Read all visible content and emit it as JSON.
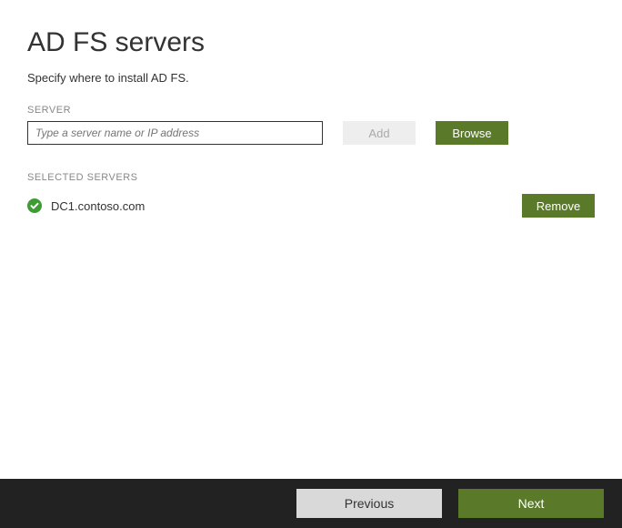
{
  "page": {
    "title": "AD FS servers",
    "subtitle": "Specify where to install AD FS."
  },
  "server_input": {
    "label": "SERVER",
    "placeholder": "Type a server name or IP address",
    "value": ""
  },
  "buttons": {
    "add": "Add",
    "browse": "Browse",
    "remove": "Remove",
    "previous": "Previous",
    "next": "Next"
  },
  "selected": {
    "label": "SELECTED SERVERS",
    "items": [
      {
        "name": "DC1.contoso.com"
      }
    ]
  },
  "colors": {
    "primary": "#5a7a29",
    "footer_bg": "#222"
  }
}
